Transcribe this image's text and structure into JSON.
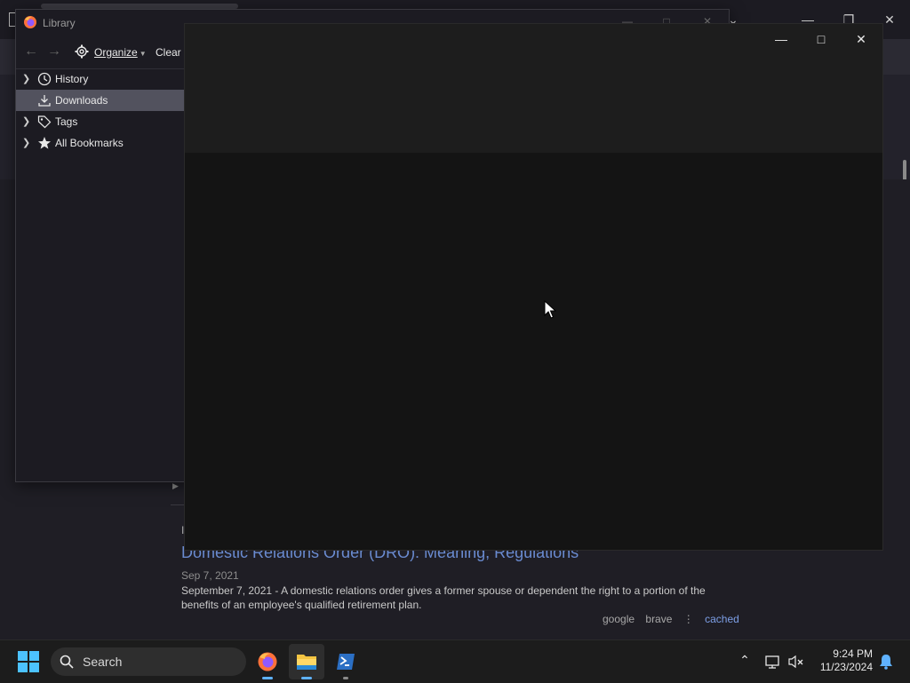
{
  "background_browser": {
    "search_result": {
      "prefix": "I",
      "title": "Domestic Relations Order (DRO): Meaning, Regulations",
      "date": "Sep 7, 2021",
      "snippet": "September 7, 2021 - A domestic relations order gives a former spouse or dependent the right to a portion of the benefits of an employee's qualified retirement plan.",
      "sources": [
        "google",
        "brave"
      ],
      "cached_label": "cached"
    }
  },
  "library": {
    "title": "Library",
    "toolbar": {
      "organize_label": "Organize",
      "clear_label": "Clear D"
    },
    "tree": [
      {
        "label": "History",
        "icon": "clock-icon",
        "expandable": true,
        "selected": false
      },
      {
        "label": "Downloads",
        "icon": "download-icon",
        "expandable": false,
        "selected": true
      },
      {
        "label": "Tags",
        "icon": "tag-icon",
        "expandable": true,
        "selected": false
      },
      {
        "label": "All Bookmarks",
        "icon": "star-icon",
        "expandable": true,
        "selected": false
      }
    ]
  },
  "taskbar": {
    "search_label": "Search",
    "apps": [
      "firefox",
      "file-explorer",
      "powershell"
    ],
    "clock_time": "9:24 PM",
    "clock_date": "11/23/2024"
  },
  "colors": {
    "selection": "#52525e",
    "link": "#6a8bd0",
    "cached": "#7d9fe6",
    "taskbar_indicator": "#5fb2ff"
  }
}
